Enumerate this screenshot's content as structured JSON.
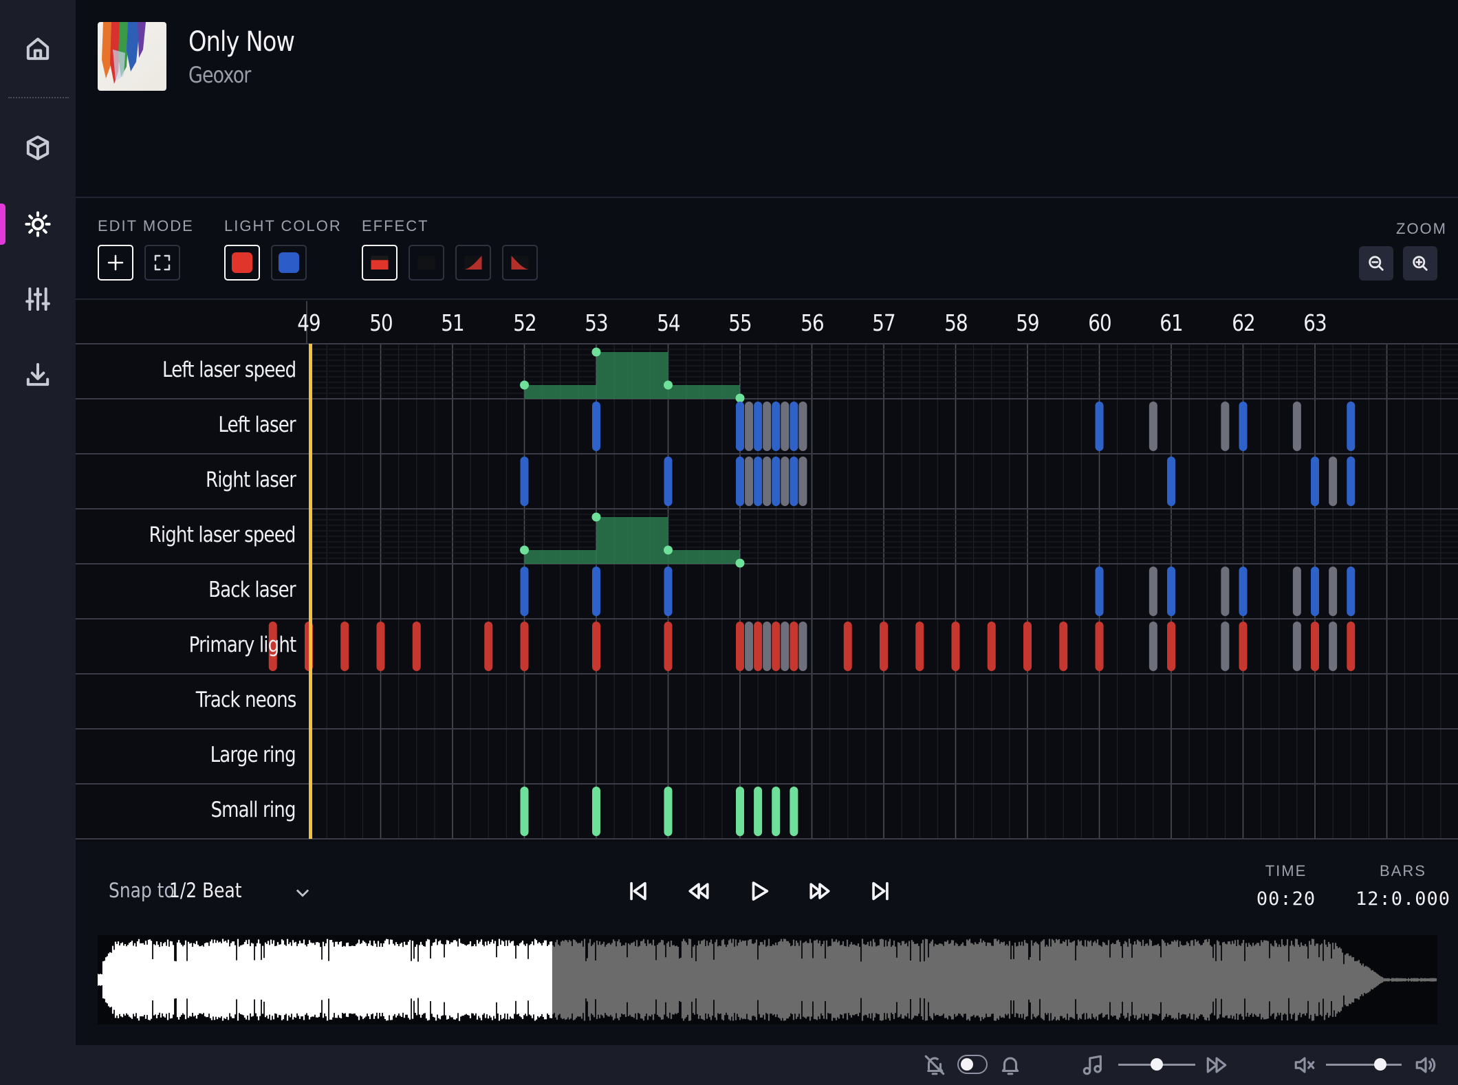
{
  "nav": {
    "items": [
      "home-icon",
      "cube-icon",
      "sun-icon",
      "sliders-icon",
      "download-icon"
    ],
    "active": "sun-icon"
  },
  "song": {
    "title": "Only Now",
    "artist": "Geoxor"
  },
  "toolbar": {
    "edit_mode_label": "EDIT MODE",
    "light_color_label": "LIGHT COLOR",
    "effect_label": "EFFECT",
    "zoom_label": "ZOOM",
    "colors": {
      "red": "#e0352a",
      "blue": "#2b5cc8"
    }
  },
  "timeline": {
    "bars": [
      49,
      50,
      51,
      52,
      53,
      54,
      55,
      56,
      57,
      58,
      59,
      60,
      61,
      62,
      63
    ],
    "rows": [
      "Left laser speed",
      "Left laser",
      "Right laser",
      "Right laser speed",
      "Back laser",
      "Primary light",
      "Track neons",
      "Large ring",
      "Small ring"
    ],
    "colors": {
      "blue": "#2f62c9",
      "red": "#c5372f",
      "gray": "#6d707b",
      "green": "#6ee09a",
      "speed_fill": "#2c7a4f",
      "cursor": "#f2c33a"
    },
    "speed_curve": [
      [
        52,
        0.25
      ],
      [
        53,
        0.85
      ],
      [
        54,
        0.25
      ],
      [
        55,
        0.0
      ]
    ],
    "events": {
      "Left laser": [
        [
          53,
          "blue"
        ],
        [
          55,
          "blue"
        ],
        [
          55.125,
          "gray"
        ],
        [
          55.25,
          "blue"
        ],
        [
          55.375,
          "gray"
        ],
        [
          55.5,
          "blue"
        ],
        [
          55.625,
          "gray"
        ],
        [
          55.75,
          "blue"
        ],
        [
          55.875,
          "gray"
        ],
        [
          60,
          "blue"
        ],
        [
          60.75,
          "gray"
        ],
        [
          61.75,
          "gray"
        ],
        [
          62,
          "blue"
        ],
        [
          62.75,
          "gray"
        ],
        [
          63.5,
          "blue"
        ]
      ],
      "Right laser": [
        [
          52,
          "blue"
        ],
        [
          54,
          "blue"
        ],
        [
          55,
          "blue"
        ],
        [
          55.125,
          "gray"
        ],
        [
          55.25,
          "blue"
        ],
        [
          55.375,
          "gray"
        ],
        [
          55.5,
          "blue"
        ],
        [
          55.625,
          "gray"
        ],
        [
          55.75,
          "blue"
        ],
        [
          55.875,
          "gray"
        ],
        [
          61,
          "blue"
        ],
        [
          63,
          "blue"
        ],
        [
          63.25,
          "gray"
        ],
        [
          63.5,
          "blue"
        ]
      ],
      "Back laser": [
        [
          52,
          "blue"
        ],
        [
          53,
          "blue"
        ],
        [
          54,
          "blue"
        ],
        [
          60,
          "blue"
        ],
        [
          60.75,
          "gray"
        ],
        [
          61,
          "blue"
        ],
        [
          61.75,
          "gray"
        ],
        [
          62,
          "blue"
        ],
        [
          62.75,
          "gray"
        ],
        [
          63,
          "blue"
        ],
        [
          63.25,
          "gray"
        ],
        [
          63.5,
          "blue"
        ]
      ],
      "Primary light": [
        [
          48.5,
          "red"
        ],
        [
          49,
          "red"
        ],
        [
          49.5,
          "red"
        ],
        [
          50,
          "red"
        ],
        [
          50.5,
          "red"
        ],
        [
          51.5,
          "red"
        ],
        [
          52,
          "red"
        ],
        [
          53,
          "red"
        ],
        [
          54,
          "red"
        ],
        [
          55,
          "red"
        ],
        [
          55.125,
          "gray"
        ],
        [
          55.25,
          "red"
        ],
        [
          55.375,
          "gray"
        ],
        [
          55.5,
          "red"
        ],
        [
          55.625,
          "gray"
        ],
        [
          55.75,
          "red"
        ],
        [
          55.875,
          "gray"
        ],
        [
          56.5,
          "red"
        ],
        [
          57,
          "red"
        ],
        [
          57.5,
          "red"
        ],
        [
          58,
          "red"
        ],
        [
          58.5,
          "red"
        ],
        [
          59,
          "red"
        ],
        [
          59.5,
          "red"
        ],
        [
          60,
          "red"
        ],
        [
          60.75,
          "gray"
        ],
        [
          61,
          "red"
        ],
        [
          61.75,
          "gray"
        ],
        [
          62,
          "red"
        ],
        [
          62.75,
          "gray"
        ],
        [
          63,
          "red"
        ],
        [
          63.25,
          "gray"
        ],
        [
          63.5,
          "red"
        ]
      ],
      "Small ring": [
        [
          52,
          "green"
        ],
        [
          53,
          "green"
        ],
        [
          54,
          "green"
        ],
        [
          55,
          "green"
        ],
        [
          55.25,
          "green"
        ],
        [
          55.5,
          "green"
        ],
        [
          55.75,
          "green"
        ]
      ]
    }
  },
  "transport": {
    "snap_label": "Snap to",
    "snap_value": "1/2 Beat",
    "time_label": "TIME",
    "time_value": "00:20",
    "bars_label": "BARS",
    "bars_value": "12:0.000",
    "playback_progress": 0.34
  },
  "statusbar": {
    "icons": [
      "bell-off-icon",
      "bell-icon",
      "music-note-icon",
      "fast-forward-icon",
      "volume-mute-icon",
      "volume-icon"
    ],
    "playback_rate": 0.5,
    "volume": 0.72
  }
}
